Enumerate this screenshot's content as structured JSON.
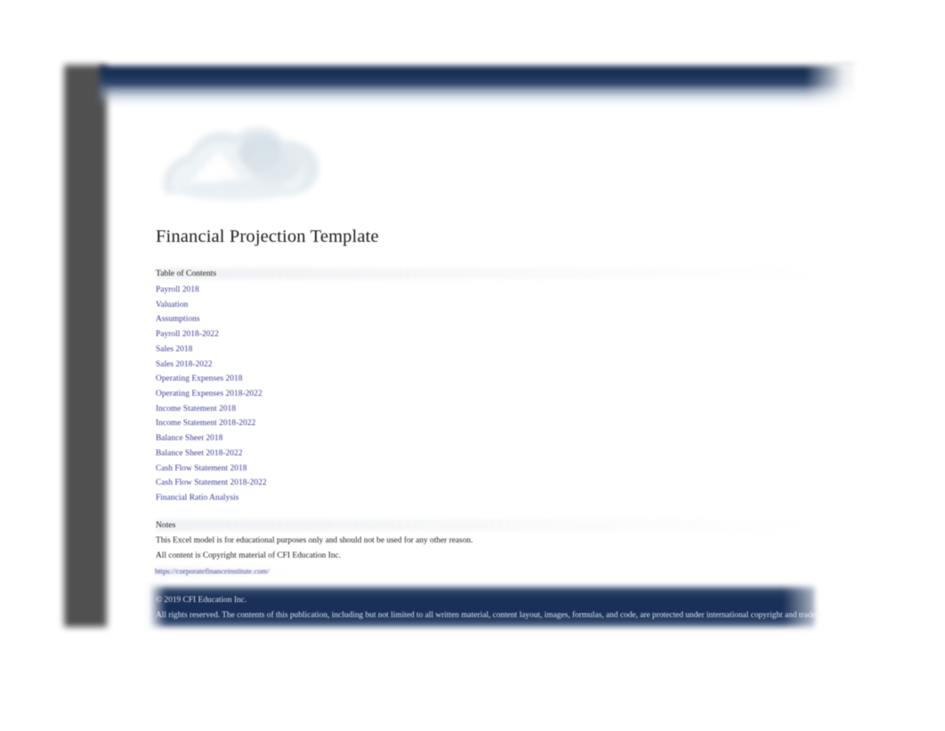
{
  "document": {
    "title": "Financial Projection Template",
    "logo_icon": "cfi-cloud-mountain-logo"
  },
  "table_of_contents": {
    "heading": "Table of Contents",
    "items": [
      {
        "label": "Payroll 2018"
      },
      {
        "label": "Valuation"
      },
      {
        "label": "Assumptions"
      },
      {
        "label": "Payroll 2018-2022"
      },
      {
        "label": "Sales 2018"
      },
      {
        "label": "Sales 2018-2022"
      },
      {
        "label": "Operating Expenses 2018"
      },
      {
        "label": "Operating Expenses 2018-2022"
      },
      {
        "label": "Income Statement 2018"
      },
      {
        "label": "Income Statement 2018-2022"
      },
      {
        "label": "Balance Sheet 2018"
      },
      {
        "label": "Balance Sheet 2018-2022"
      },
      {
        "label": "Cash Flow Statement 2018"
      },
      {
        "label": "Cash Flow Statement 2018-2022"
      },
      {
        "label": "Financial Ratio Analysis"
      }
    ]
  },
  "notes": {
    "heading": "Notes",
    "line_1": "This Excel model is for educational purposes only and should not be used for any other reason.",
    "line_2": "All content is Copyright material of CFI Education Inc.",
    "url": "https://corporatefinanceinstitute.com/"
  },
  "footer": {
    "copyright": "© 2019 CFI Education Inc.",
    "rights": "All rights reserved.  The contents of this publication, including but not limited to all written material, content layout, images, formulas, and code, are protected under international copyright and tradem"
  },
  "colors": {
    "navy_band": "#1b3055",
    "link": "#3b3b96",
    "left_rail": "#4b4b4b",
    "body_text": "#1d1d1d",
    "footer_text": "#dfe6ef"
  }
}
